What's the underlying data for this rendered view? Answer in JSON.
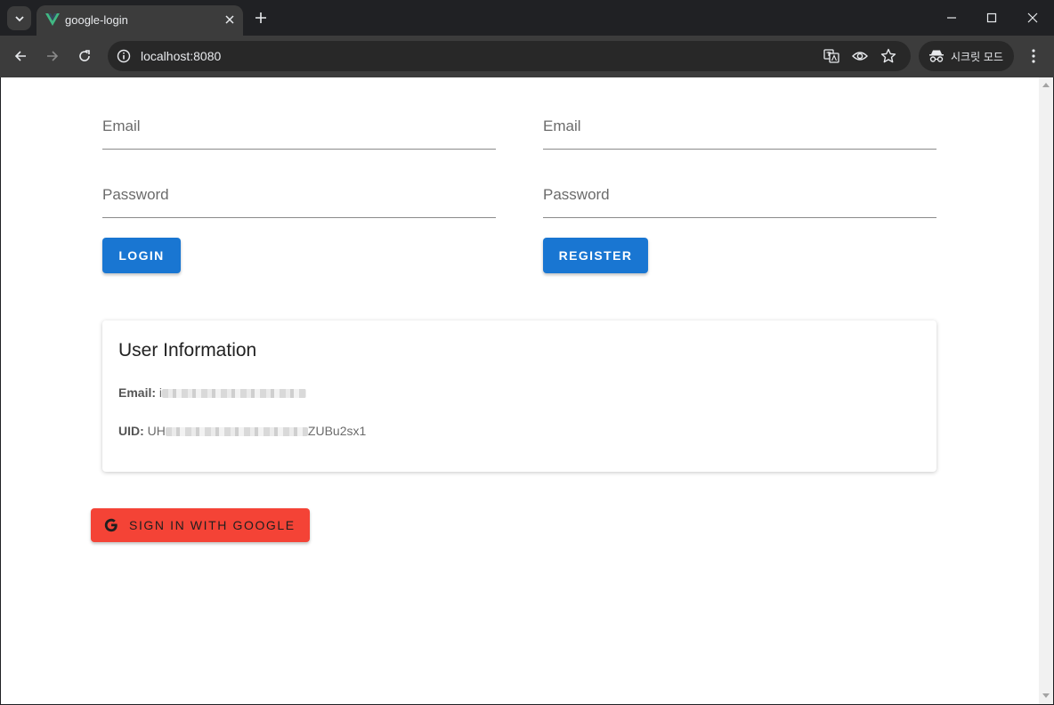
{
  "browser": {
    "tab_title": "google-login",
    "url": "localhost:8080",
    "incognito_label": "시크릿 모드"
  },
  "login": {
    "email_label": "Email",
    "password_label": "Password",
    "button_label": "LOGIN"
  },
  "register": {
    "email_label": "Email",
    "password_label": "Password",
    "button_label": "REGISTER"
  },
  "user_info": {
    "title": "User Information",
    "email_key": "Email:",
    "email_visible_prefix": "i",
    "uid_key": "UID:",
    "uid_visible_prefix": "UH",
    "uid_visible_suffix": "ZUBu2sx1"
  },
  "google_button": {
    "label": "SIGN IN WITH GOOGLE"
  },
  "colors": {
    "primary_button": "#1976d2",
    "google_button": "#f44336",
    "browser_frame": "#202124",
    "toolbar": "#3c3c3c"
  }
}
